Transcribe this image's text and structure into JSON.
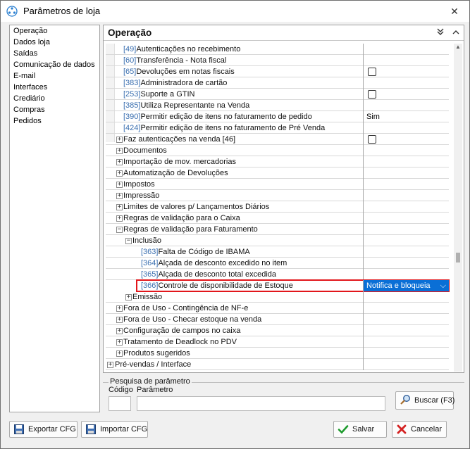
{
  "window": {
    "title": "Parâmetros de loja",
    "close_icon": "close-icon"
  },
  "sidebar": {
    "items": [
      {
        "label": "Operação"
      },
      {
        "label": "Dados loja"
      },
      {
        "label": "Saídas"
      },
      {
        "label": "Comunicação de dados"
      },
      {
        "label": "E-mail"
      },
      {
        "label": "Interfaces"
      },
      {
        "label": "Crediário"
      },
      {
        "label": "Compras"
      },
      {
        "label": "Pedidos"
      }
    ]
  },
  "main": {
    "title": "Operação",
    "rows": [
      {
        "code": "[49]",
        "text": "Autenticações no recebimento",
        "value": ""
      },
      {
        "code": "[60]",
        "text": "Transferência - Nota fiscal",
        "value": ""
      },
      {
        "code": "[65]",
        "text": "Devoluções em notas fiscais",
        "value": ""
      },
      {
        "code": "[383]",
        "text": "Administradora de cartão",
        "value": ""
      },
      {
        "code": "[253]",
        "text": "Suporte a GTIN",
        "value": ""
      },
      {
        "code": "[385]",
        "text": "Utiliza Representante na Venda",
        "value": ""
      },
      {
        "code": "[390]",
        "text": "Permitir edição de itens no faturamento de pedido",
        "value": "Sim"
      },
      {
        "code": "[424]",
        "text": "Permitir edição de itens no faturamento de Pré Venda",
        "value": ""
      },
      {
        "code": "",
        "text": "Faz autenticações na venda [46]",
        "value": ""
      },
      {
        "code": "",
        "text": "Documentos",
        "value": ""
      },
      {
        "code": "",
        "text": "Importação de mov. mercadorias",
        "value": ""
      },
      {
        "code": "",
        "text": "Automatização de Devoluções",
        "value": ""
      },
      {
        "code": "",
        "text": "Impostos",
        "value": ""
      },
      {
        "code": "",
        "text": "Impressão",
        "value": ""
      },
      {
        "code": "",
        "text": "Limites de valores p/ Lançamentos Diários",
        "value": ""
      },
      {
        "code": "",
        "text": "Regras de validação para o Caixa",
        "value": ""
      },
      {
        "code": "",
        "text": "Regras de validação para Faturamento",
        "value": ""
      },
      {
        "code": "",
        "text": "Inclusão",
        "value": ""
      },
      {
        "code": "[363]",
        "text": "Falta de Código de IBAMA",
        "value": ""
      },
      {
        "code": "[364]",
        "text": "Alçada de desconto excedido no item",
        "value": ""
      },
      {
        "code": "[365]",
        "text": "Alçada de desconto total excedida",
        "value": ""
      },
      {
        "code": "[366]",
        "text": "Controle de disponibilidade de Estoque",
        "value": "Notifica e bloqueia"
      },
      {
        "code": "",
        "text": "Emissão",
        "value": ""
      },
      {
        "code": "",
        "text": "Fora de Uso - Contingência de NF-e",
        "value": ""
      },
      {
        "code": "",
        "text": "Fora de Uso - Checar estoque na venda",
        "value": ""
      },
      {
        "code": "",
        "text": "Configuração de campos no caixa",
        "value": ""
      },
      {
        "code": "",
        "text": "Tratamento de Deadlock no PDV",
        "value": ""
      },
      {
        "code": "",
        "text": "Produtos sugeridos",
        "value": ""
      },
      {
        "code": "",
        "text": "Pré-vendas / Interface",
        "value": ""
      }
    ]
  },
  "search": {
    "legend": "Pesquisa de parâmetro",
    "code_label": "Código",
    "param_label": "Parâmetro",
    "code_value": "",
    "param_value": "",
    "button_label": "Buscar (F3)"
  },
  "footer": {
    "export_label": "Exportar CFG",
    "import_label": "Importar CFG",
    "save_label": "Salvar",
    "cancel_label": "Cancelar"
  }
}
